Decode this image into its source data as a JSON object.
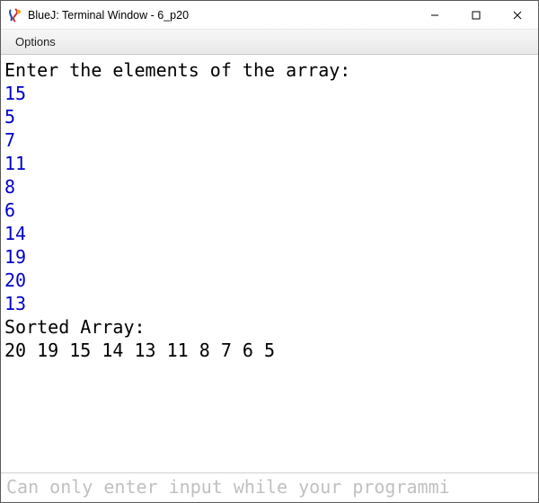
{
  "window": {
    "title": "BlueJ: Terminal Window - 6_p20",
    "controls": {
      "min": "—",
      "max": "☐",
      "close": "✕"
    }
  },
  "menubar": {
    "items": [
      {
        "label": "Options"
      }
    ]
  },
  "terminal": {
    "lines": [
      {
        "type": "stdout",
        "text": "Enter the elements of the array:"
      },
      {
        "type": "stdin",
        "text": "15"
      },
      {
        "type": "stdin",
        "text": "5"
      },
      {
        "type": "stdin",
        "text": "7"
      },
      {
        "type": "stdin",
        "text": "11"
      },
      {
        "type": "stdin",
        "text": "8"
      },
      {
        "type": "stdin",
        "text": "6"
      },
      {
        "type": "stdin",
        "text": "14"
      },
      {
        "type": "stdin",
        "text": "19"
      },
      {
        "type": "stdin",
        "text": "20"
      },
      {
        "type": "stdin",
        "text": "13"
      },
      {
        "type": "stdout",
        "text": "Sorted Array:"
      },
      {
        "type": "stdout",
        "text": "20 19 15 14 13 11 8 7 6 5"
      }
    ]
  },
  "input": {
    "placeholder": "Can only enter input while your programmi",
    "value": ""
  },
  "icons": {
    "bluej": "bluej-icon"
  }
}
